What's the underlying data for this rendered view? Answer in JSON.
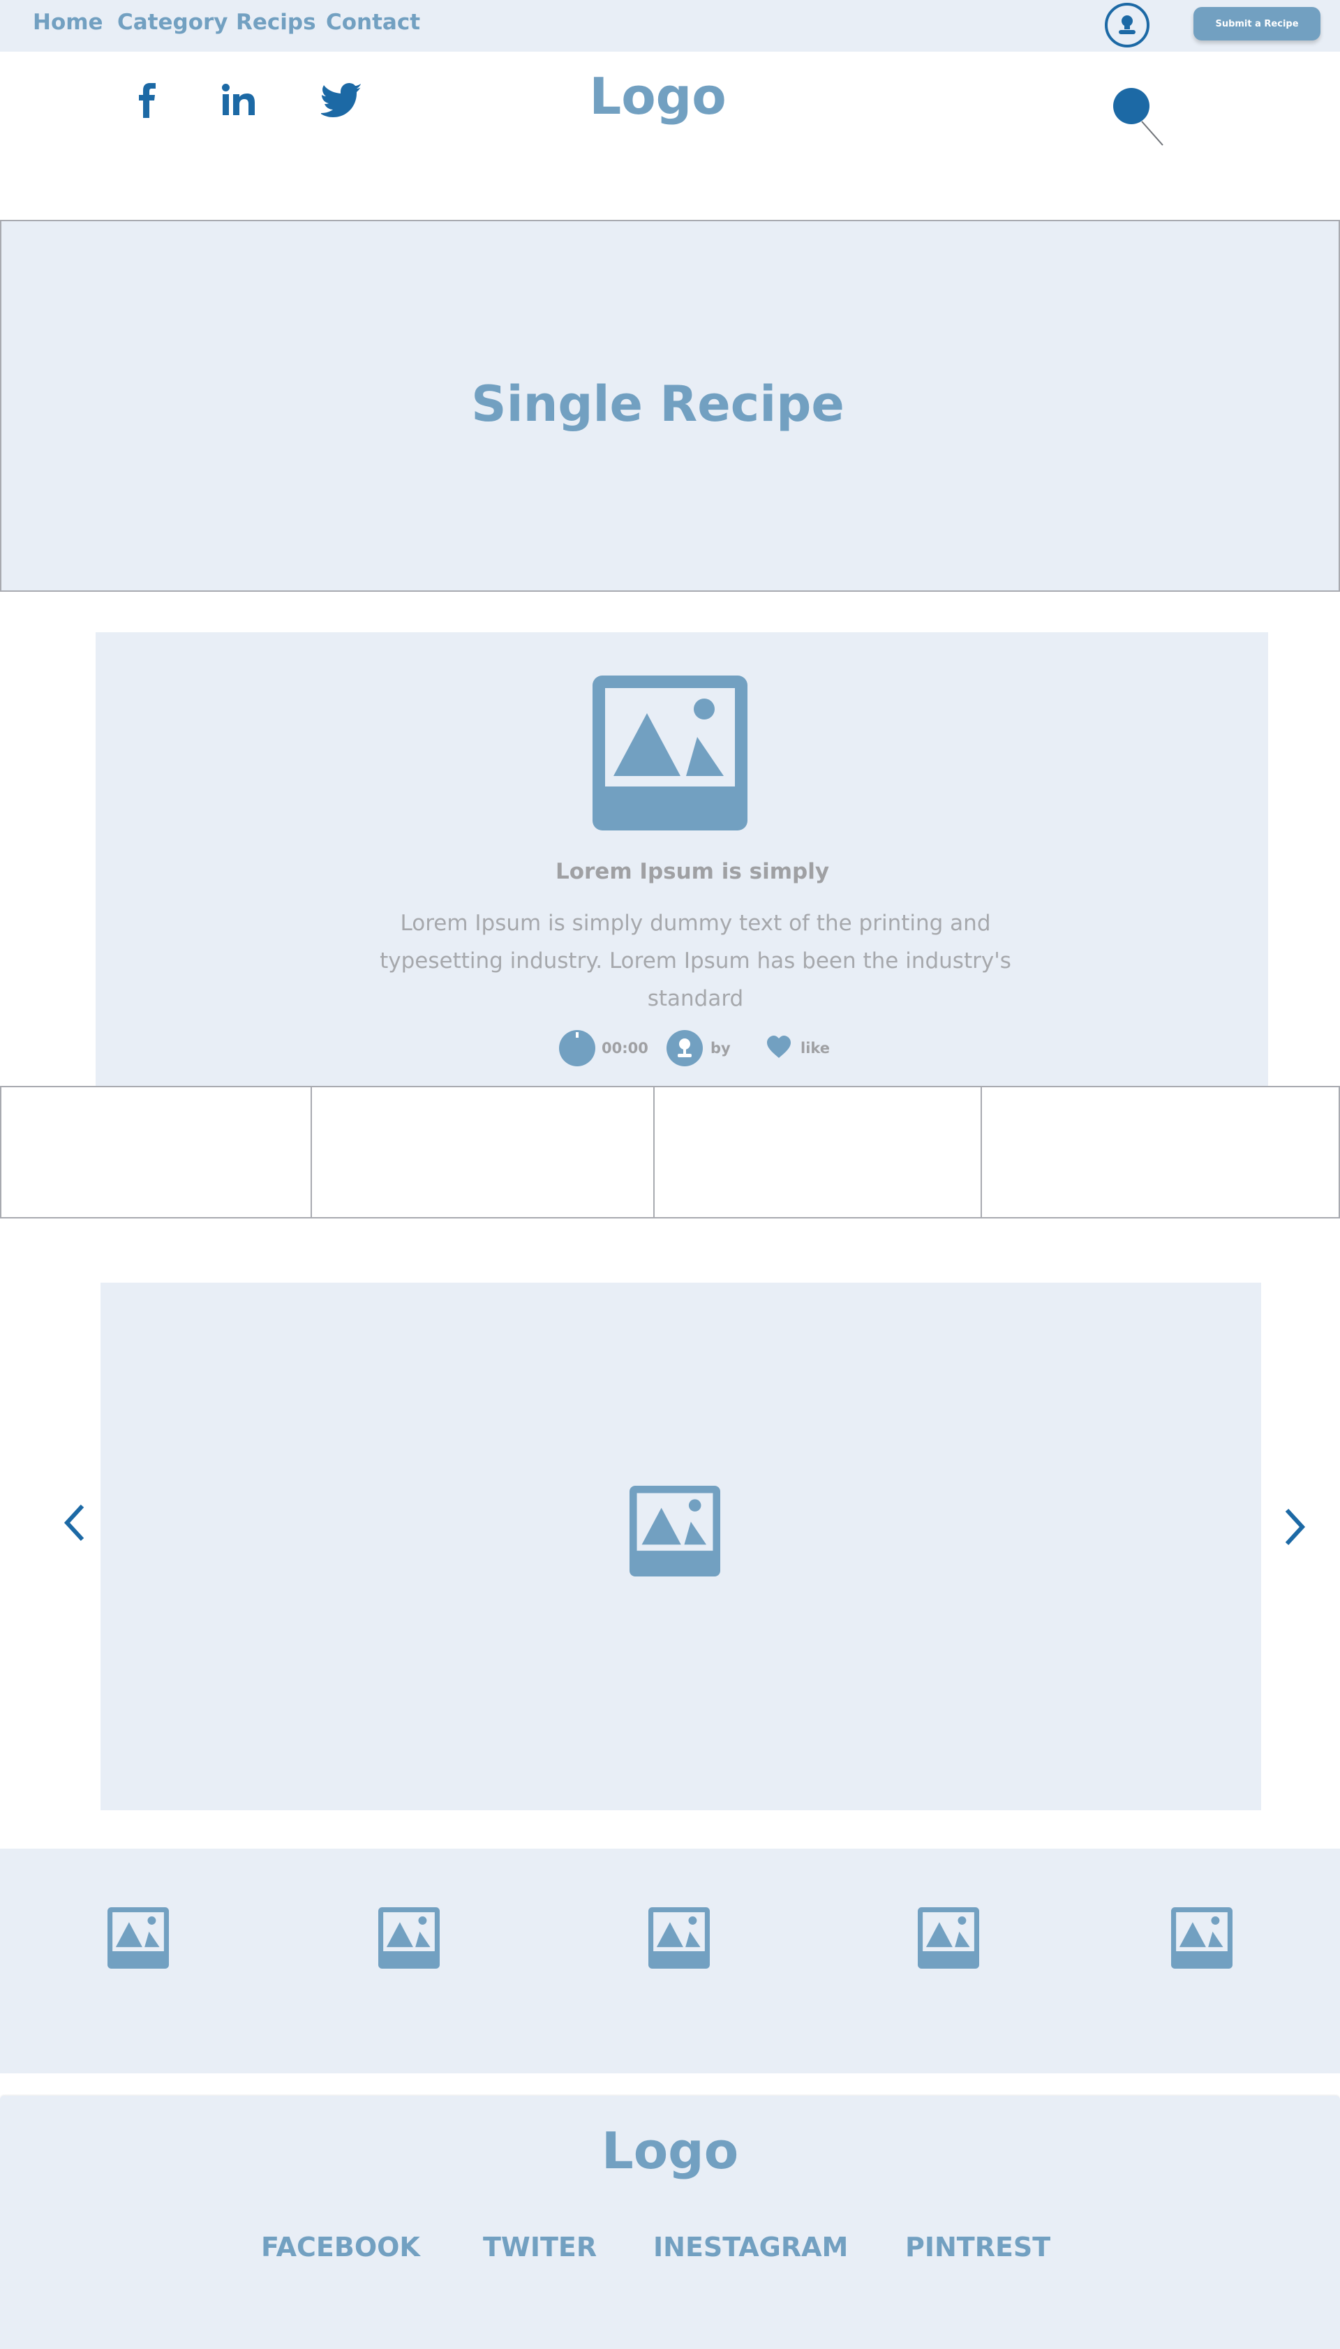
{
  "nav": {
    "links": [
      "Home",
      "Category",
      "Recips",
      "Contact"
    ],
    "submit_label": "Submit a Recipe"
  },
  "header": {
    "logo": "Logo",
    "social_icons": [
      "facebook-icon",
      "linkedin-icon",
      "twitter-icon"
    ],
    "search_icon": "search-icon"
  },
  "hero": {
    "title": "Single Recipe"
  },
  "recipe_card": {
    "title": "Lorem Ipsum is simply",
    "description": "Lorem Ipsum is simply dummy text of the printing and typesetting industry. Lorem Ipsum has been the industry's standard",
    "time": "00:00",
    "author": "by",
    "like": "like"
  },
  "footer": {
    "logo": "Logo",
    "links": [
      "FACEBOOK",
      "TWITER",
      "INESTAGRAM",
      "PINTREST"
    ]
  },
  "colors": {
    "brand": "#72a0c1",
    "dark_brand": "#1c69a5",
    "panel": "#e8eef6",
    "muted_text": "#9fa0a3"
  }
}
